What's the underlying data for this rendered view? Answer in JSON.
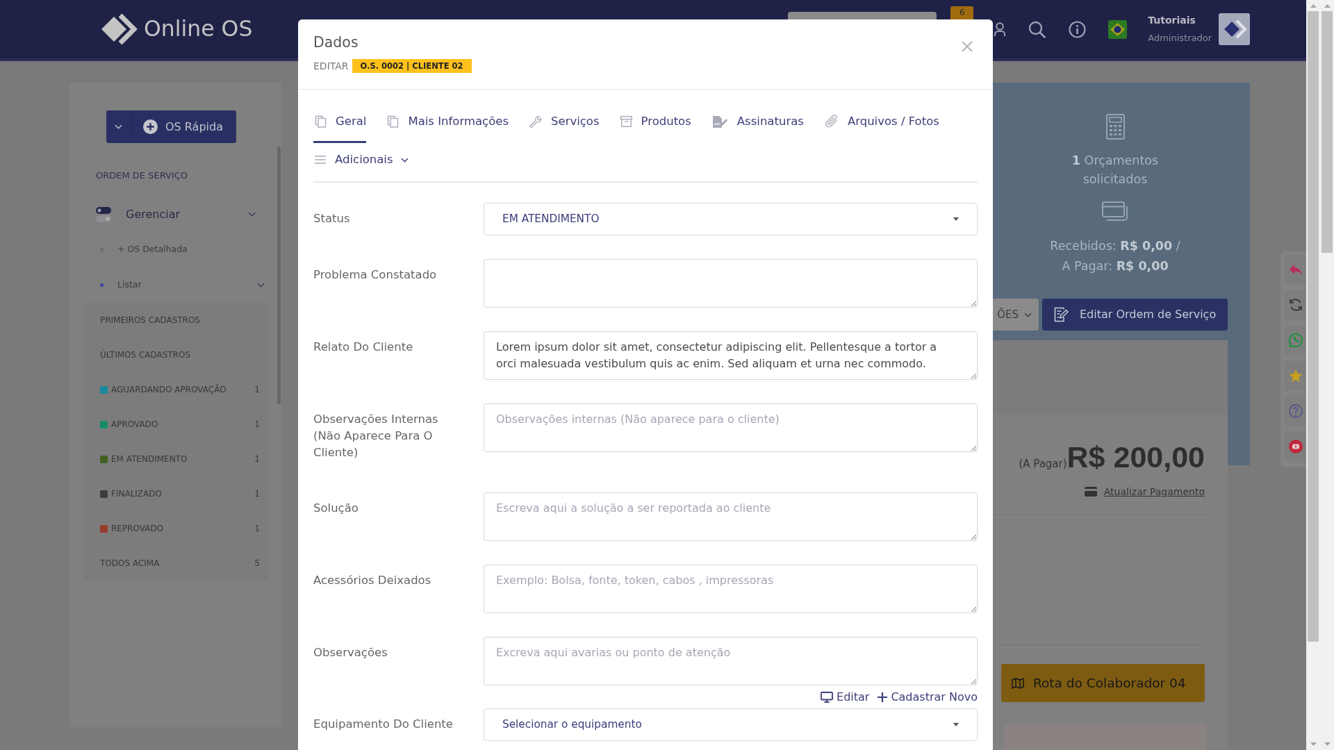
{
  "navbar": {
    "logo": "Online OS",
    "badge": "6",
    "user_name": "Tutoriais",
    "user_role": "Administrador"
  },
  "sidebar": {
    "quick_button": "OS Rápida",
    "section": "ORDEM DE SERVIÇO",
    "menu": [
      {
        "label": "Gerenciar",
        "children": [
          {
            "label": "+ OS Detalhada",
            "selected": false
          },
          {
            "label": "Listar",
            "selected": true,
            "children": [
              {
                "label": "PRIMEIROS CADASTROS"
              },
              {
                "label": "ÚLTIMOS CADASTROS"
              },
              {
                "label": "AGUARDANDO APROVAÇÃO",
                "color": "#178a9e",
                "count": "1"
              },
              {
                "label": "APROVADO",
                "color": "#178a6c",
                "count": "1"
              },
              {
                "label": "EM ATENDIMENTO",
                "color": "#3f6322",
                "count": "1"
              },
              {
                "label": "FINALIZADO",
                "color": "#3c3c3c",
                "count": "1"
              },
              {
                "label": "REPROVADO",
                "color": "#9a3b2e",
                "count": "1"
              },
              {
                "label": "TODOS ACIMA",
                "count": "5"
              }
            ]
          }
        ]
      }
    ]
  },
  "summary": {
    "budgets": "**1** Orçamentos solicitados",
    "received": "Recebidos: **R$ 0,00** /",
    "to_pay": "A Pagar: **R$ 0,00**",
    "menu_button": "ÕES",
    "edit_button": "Editar Ordem de Serviço"
  },
  "payment": {
    "caption": "(A Pagar)",
    "amount": "R$ 200,00",
    "link": "Atualizar Pagamento",
    "route_button": "Rota do Colaborador 04"
  },
  "modal": {
    "title": "Dados",
    "mode": "EDITAR",
    "badge": "O.S. 0002 | CLIENTE 02",
    "tabs": [
      {
        "label": "Geral",
        "selected": true,
        "kind": "tab"
      },
      {
        "label": "Mais Informações",
        "selected": false,
        "kind": "tab"
      },
      {
        "label": "Serviços",
        "selected": false,
        "kind": "tab"
      },
      {
        "label": "Produtos",
        "selected": false,
        "kind": "tab"
      },
      {
        "label": "Assinaturas",
        "selected": false,
        "kind": "tab"
      },
      {
        "label": "Arquivos / Fotos",
        "selected": false,
        "kind": "tab"
      },
      {
        "label": "Adicionais",
        "selected": false,
        "kind": "dropdown"
      }
    ],
    "fields": [
      {
        "label": "Status",
        "kind": "select",
        "value": "EM ATENDIMENTO"
      },
      {
        "label": "Problema Constatado",
        "kind": "textarea"
      },
      {
        "label": "Relato Do Cliente",
        "kind": "textarea",
        "value": "Lorem ipsum dolor sit amet, consectetur adipiscing elit. Pellentesque a tortor a orci malesuada vestibulum quis ac enim. Sed aliquam et urna nec commodo."
      },
      {
        "label": "Observações Internas (Não Aparece Para O Cliente)",
        "kind": "textarea",
        "placeholder": "Observações internas (Não aparece para o cliente)"
      },
      {
        "label": "Solução",
        "kind": "textarea",
        "placeholder": "Escreva aqui a solução a ser reportada ao cliente"
      },
      {
        "label": "Acessórios Deixados",
        "kind": "textarea",
        "placeholder": "Exemplo: Bolsa, fonte, token, cabos , impressoras"
      },
      {
        "label": "Observações",
        "kind": "textarea",
        "placeholder": "Excreva aqui avarias ou ponto de atenção"
      },
      {
        "label": "Equipamento Do Cliente",
        "kind": "select",
        "value": "Selecionar o equipamento",
        "actions": [
          {
            "label": "Editar",
            "kind": "edit"
          },
          {
            "label": "Cadastrar Novo",
            "kind": "add"
          }
        ]
      }
    ]
  }
}
